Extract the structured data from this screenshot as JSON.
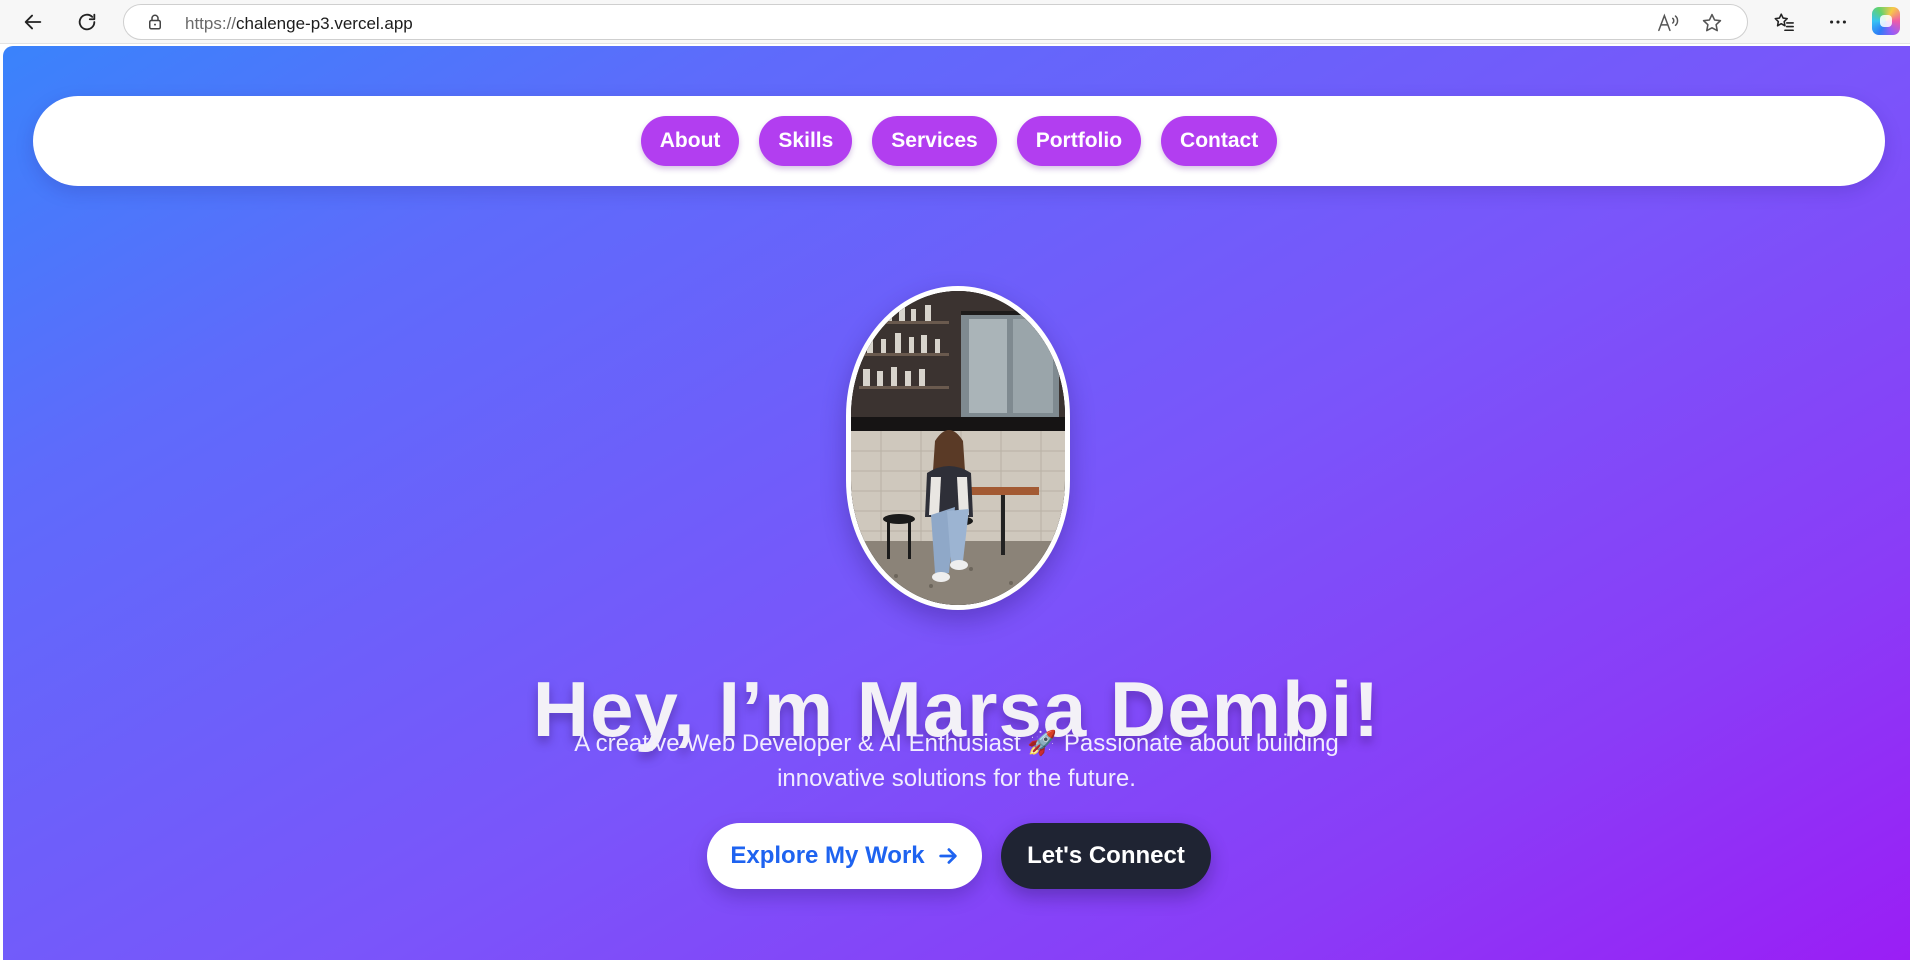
{
  "browser": {
    "url_scheme": "https://",
    "url_host": "chalenge-p3.vercel.app",
    "icons": [
      "back-arrow-icon",
      "refresh-icon",
      "lock-icon",
      "read-aloud-icon",
      "star-icon",
      "favorites-icon",
      "more-icon",
      "copilot-icon"
    ]
  },
  "nav": {
    "items": [
      {
        "label": "About"
      },
      {
        "label": "Skills"
      },
      {
        "label": "Services"
      },
      {
        "label": "Portfolio"
      },
      {
        "label": "Contact"
      }
    ]
  },
  "hero": {
    "title": "Hey, I’m Marsa Dembi!",
    "subtitle": "A creative Web Developer & AI Enthusiast 🚀 Passionate about building innovative solutions for the future.",
    "primary_button": "Explore My Work",
    "secondary_button": "Let's Connect"
  },
  "colors": {
    "nav_pill": "#b23ef0",
    "gradient_start": "#3a83fb",
    "gradient_end": "#9a1ef5",
    "primary_button_text": "#1e63f0",
    "secondary_button_bg": "#1f2433"
  }
}
